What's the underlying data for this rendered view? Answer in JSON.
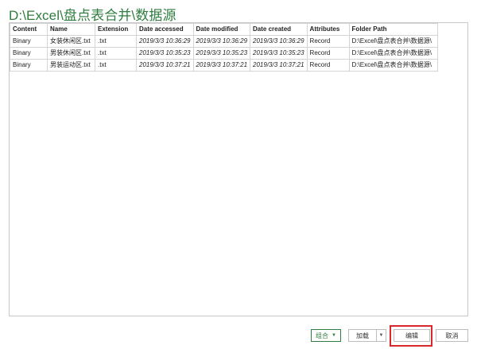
{
  "title": "D:\\Excel\\盘点表合并\\数据源",
  "table": {
    "columns": [
      "Content",
      "Name",
      "Extension",
      "Date accessed",
      "Date modified",
      "Date created",
      "Attributes",
      "Folder Path"
    ],
    "rows": [
      [
        "Binary",
        "女装休闲区.txt",
        ".txt",
        "2019/3/3 10:36:29",
        "2019/3/3 10:36:29",
        "2019/3/3 10:36:29",
        "Record",
        "D:\\Excel\\盘点表合并\\数据源\\"
      ],
      [
        "Binary",
        "男装休闲区.txt",
        ".txt",
        "2019/3/3 10:35:23",
        "2019/3/3 10:35:23",
        "2019/3/3 10:35:23",
        "Record",
        "D:\\Excel\\盘点表合并\\数据源\\"
      ],
      [
        "Binary",
        "男装运动区.txt",
        ".txt",
        "2019/3/3 10:37:21",
        "2019/3/3 10:37:21",
        "2019/3/3 10:37:21",
        "Record",
        "D:\\Excel\\盘点表合并\\数据源\\"
      ]
    ]
  },
  "buttons": {
    "combine": "组合",
    "load": "加载",
    "edit": "编辑",
    "cancel": "取消"
  },
  "icons": {
    "combine_dropdown": "chevron-down-icon",
    "load_dropdown": "chevron-down-icon"
  },
  "colors": {
    "title": "#2f7d3f",
    "highlight": "#d9272e"
  }
}
